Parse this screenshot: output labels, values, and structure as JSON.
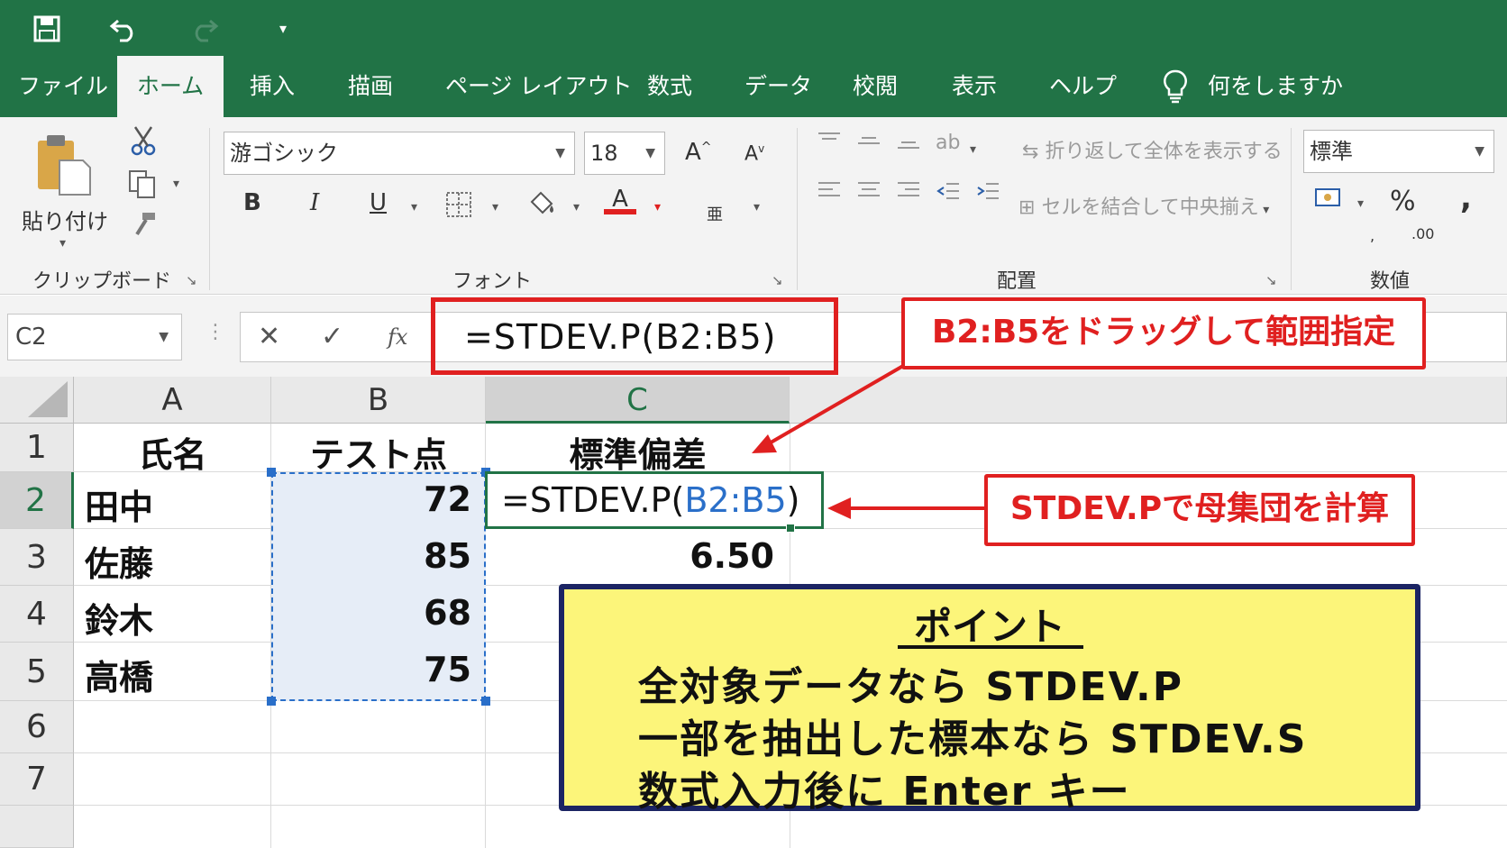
{
  "colors": {
    "excel_green": "#217346",
    "annotation_red": "#e02020",
    "point_bg": "#fcf57a",
    "point_border": "#1b2463",
    "ref_blue": "#2a6fc9"
  },
  "quick_access": {
    "icons": [
      "save-icon",
      "undo-icon",
      "redo-icon",
      "customize-qa-icon"
    ]
  },
  "tabs": [
    "ファイル",
    "ホーム",
    "挿入",
    "描画",
    "ページ レイアウト",
    "数式",
    "データ",
    "校閲",
    "表示",
    "ヘルプ"
  ],
  "tell_me": "何をしますか",
  "ribbon": {
    "clipboard": {
      "paste": "貼り付け",
      "group": "クリップボード"
    },
    "font": {
      "name": "游ゴシック",
      "size": "18",
      "bold": "B",
      "italic": "I",
      "underline": "U",
      "font_color": "A",
      "grow": "A",
      "shrink": "A",
      "phonetic": "亜",
      "group": "フォント"
    },
    "alignment": {
      "wrap": "折り返して全体を表示する",
      "merge": "セルを結合して中央揃え",
      "group": "配置"
    },
    "number": {
      "format": "標準",
      "percent": "%",
      "comma": ",",
      "group": "数値"
    }
  },
  "formula_bar": {
    "name_box": "C2",
    "fx": "fx",
    "formula": "=STDEV.P(B2:B5)"
  },
  "columns": [
    "A",
    "B",
    "C"
  ],
  "rows": [
    "1",
    "2",
    "3",
    "4",
    "5",
    "6",
    "7"
  ],
  "cells": {
    "A1": "氏名",
    "B1": "テスト点",
    "C1": "標準偏差",
    "A2": "田中",
    "B2": "72",
    "A3": "佐藤",
    "B3": "85",
    "C3": "6.50",
    "A4": "鈴木",
    "B4": "68",
    "A5": "高橋",
    "B5": "75"
  },
  "c2_edit": {
    "prefix": "=STDEV.P(",
    "ref": "B2:B5",
    "suffix": ")"
  },
  "annotations": {
    "drag": "B2:B5をドラッグして範囲指定",
    "population": "STDEV.Pで母集団を計算"
  },
  "point": {
    "title": "ポイント",
    "lines": [
      "全対象データなら STDEV.P",
      "一部を抽出した標本なら STDEV.S",
      "数式入力後に Enter キー"
    ]
  }
}
